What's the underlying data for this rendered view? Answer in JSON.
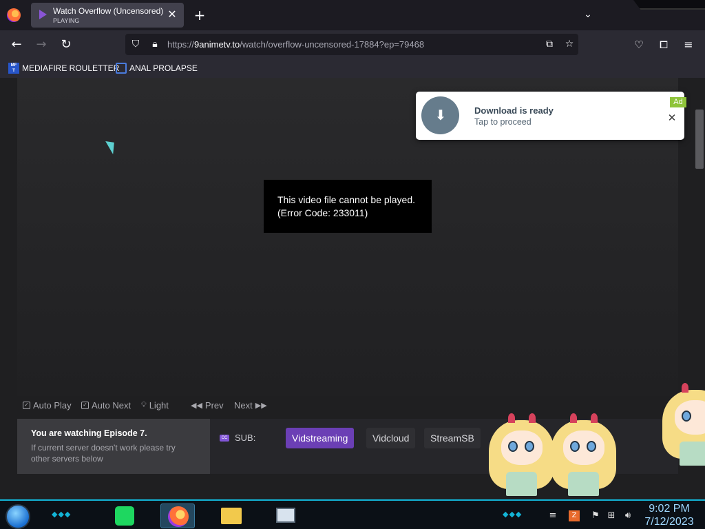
{
  "browser": {
    "tab": {
      "title": "Watch Overflow (Uncensored)",
      "status": "PLAYING"
    },
    "url": {
      "scheme": "https://",
      "host": "9animetv.to",
      "path": "/watch/overflow-uncensored-17884?ep=79468"
    },
    "bookmarks": [
      {
        "label": "MEDIAFIRE ROULETTER",
        "icon": "mediafire-icon"
      },
      {
        "label": "ANAL PROLAPSE",
        "icon": "bookmark-icon"
      }
    ]
  },
  "player": {
    "error_line1": "This video file cannot be played.",
    "error_line2": "(Error Code: 233011)"
  },
  "controls": {
    "auto_play": "Auto Play",
    "auto_next": "Auto Next",
    "light": "Light",
    "prev": "Prev",
    "next": "Next"
  },
  "servers": {
    "watching": "You are watching Episode 7.",
    "note": "If current server doesn't work please try other servers below",
    "sub_label": "SUB:",
    "items": [
      "Vidstreaming",
      "Vidcloud",
      "StreamSB"
    ],
    "active": "Vidstreaming"
  },
  "ad": {
    "title": "Download is ready",
    "subtitle": "Tap to proceed",
    "badge": "Ad"
  },
  "taskbar": {
    "time": "9:02 PM",
    "date": "7/12/2023"
  },
  "colors": {
    "accent_purple": "#6b3fb5",
    "taskbar_accent": "#13b4d6",
    "ad_badge": "#8fc43a"
  }
}
